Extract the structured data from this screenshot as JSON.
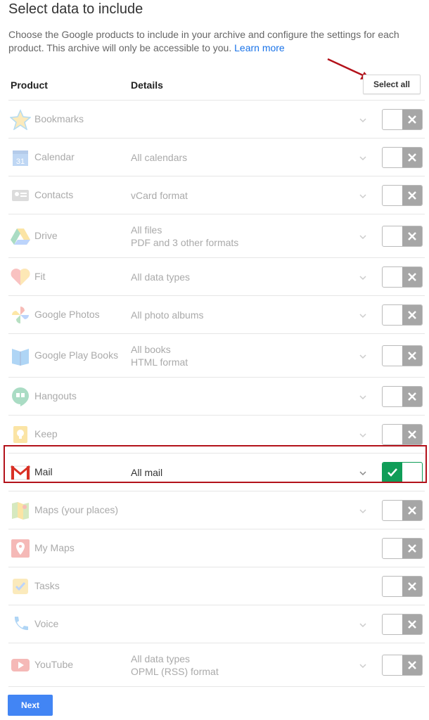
{
  "page": {
    "title": "Select data to include",
    "description": "Choose the Google products to include in your archive and configure the settings for each product. This archive will only be accessible to you.",
    "learn_more": "Learn more"
  },
  "table": {
    "header_product": "Product",
    "header_details": "Details",
    "select_all": "Select all"
  },
  "products": [
    {
      "name": "Bookmarks",
      "details": [],
      "icon": "bookmarks-star-icon",
      "on": false
    },
    {
      "name": "Calendar",
      "details": [
        "All calendars"
      ],
      "icon": "calendar-icon",
      "icon_text": "31",
      "on": false
    },
    {
      "name": "Contacts",
      "details": [
        "vCard format"
      ],
      "icon": "contacts-card-icon",
      "on": false
    },
    {
      "name": "Drive",
      "details": [
        "All files",
        "PDF and 3 other formats"
      ],
      "icon": "drive-icon",
      "on": false
    },
    {
      "name": "Fit",
      "details": [
        "All data types"
      ],
      "icon": "fit-heart-icon",
      "on": false
    },
    {
      "name": "Google Photos",
      "details": [
        "All photo albums"
      ],
      "icon": "photos-pinwheel-icon",
      "on": false
    },
    {
      "name": "Google Play Books",
      "details": [
        "All books",
        "HTML format"
      ],
      "icon": "play-books-icon",
      "on": false
    },
    {
      "name": "Hangouts",
      "details": [],
      "icon": "hangouts-icon",
      "on": false
    },
    {
      "name": "Keep",
      "details": [],
      "icon": "keep-bulb-icon",
      "on": false
    },
    {
      "name": "Mail",
      "details": [
        "All mail"
      ],
      "icon": "gmail-icon",
      "on": true
    },
    {
      "name": "Maps (your places)",
      "details": [],
      "icon": "maps-icon",
      "on": false
    },
    {
      "name": "My Maps",
      "details": [],
      "icon": "my-maps-pin-icon",
      "on": false,
      "no_chevron": true
    },
    {
      "name": "Tasks",
      "details": [],
      "icon": "tasks-check-icon",
      "on": false,
      "no_chevron": true
    },
    {
      "name": "Voice",
      "details": [],
      "icon": "voice-phone-icon",
      "on": false
    },
    {
      "name": "YouTube",
      "details": [
        "All data types",
        "OPML (RSS) format"
      ],
      "icon": "youtube-play-icon",
      "on": false
    }
  ],
  "footer": {
    "next": "Next"
  },
  "colors": {
    "accent_blue": "#4285f4",
    "toggle_on": "#0f9d58",
    "toggle_off": "#a6a6a6",
    "annotation_red": "#b3121b"
  }
}
